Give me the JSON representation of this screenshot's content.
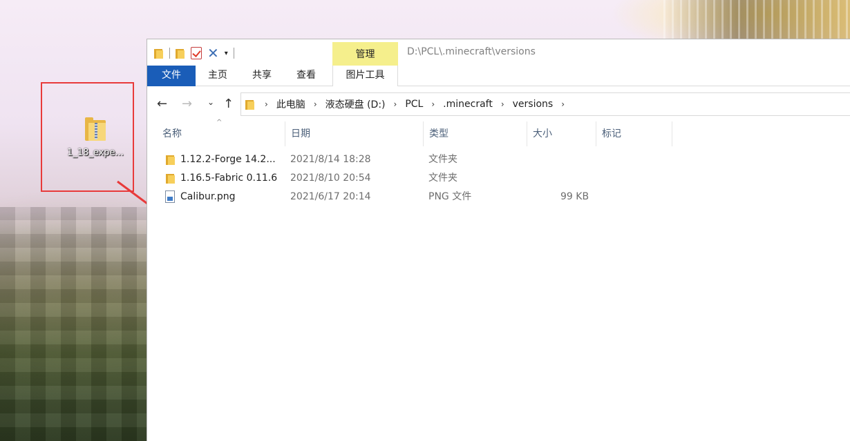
{
  "desktop": {
    "item_label": "1_18_expe..."
  },
  "window": {
    "path_title": "D:\\PCL\\.minecraft\\versions",
    "manage_tab": "管理",
    "ribbon_tabs": {
      "file": "文件",
      "home": "主页",
      "share": "共享",
      "view": "查看",
      "picture_tools": "图片工具"
    },
    "breadcrumb": [
      "此电脑",
      "液态硬盘 (D:)",
      "PCL",
      ".minecraft",
      "versions"
    ],
    "columns": [
      "名称",
      "日期",
      "类型",
      "大小",
      "标记"
    ],
    "files": [
      {
        "name": "1.12.2-Forge 14.2...",
        "date": "2021/8/14 18:28",
        "type": "文件夹",
        "size": "",
        "icon": "folder-icon"
      },
      {
        "name": "1.16.5-Fabric 0.11.6",
        "date": "2021/8/10 20:54",
        "type": "文件夹",
        "size": "",
        "icon": "folder-icon"
      },
      {
        "name": "Calibur.png",
        "date": "2021/6/17 20:14",
        "type": "PNG 文件",
        "size": "99 KB",
        "icon": "png-file-icon"
      }
    ]
  },
  "colors": {
    "accent": "#1a5db8",
    "manage_tab_bg": "#f5ef8c",
    "annotation_red": "#e83a3a",
    "folder_yellow": "#f7cf5b"
  }
}
